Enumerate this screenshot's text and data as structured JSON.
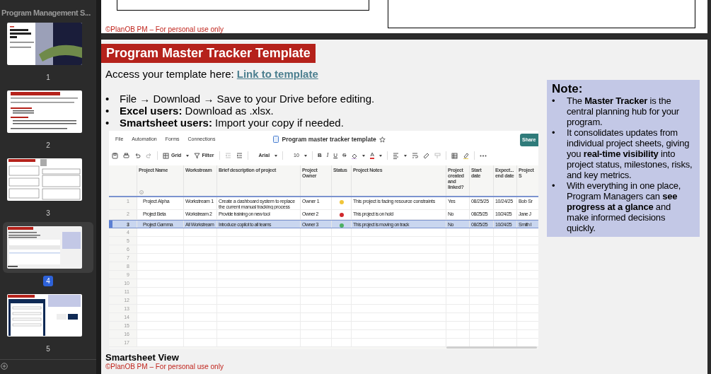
{
  "app": {
    "title": "Program Management S..."
  },
  "slides": [
    {
      "number": "1",
      "kind": "cover",
      "selected": false
    },
    {
      "number": "2",
      "kind": "text",
      "selected": false
    },
    {
      "number": "3",
      "kind": "form",
      "selected": false
    },
    {
      "number": "4",
      "kind": "tracker",
      "selected": true
    },
    {
      "number": "5",
      "kind": "intake",
      "selected": false
    }
  ],
  "previous_slide": {
    "footer": "©PlanOB PM – For personal use only"
  },
  "slide": {
    "title": "Program Master Tracker Template",
    "access_text": "Access your template here:",
    "link": "Link to template",
    "bullets": [
      {
        "marker": "•",
        "text": "File →  Download → Save to your Drive before editing."
      },
      {
        "marker": "•",
        "text": "**Excel users:** Download as .xlsx."
      },
      {
        "marker": "•",
        "text": "**Smartsheet users:** Import your copy if needed."
      }
    ],
    "sheet": {
      "menu": [
        "File",
        "Automation",
        "Forms",
        "Connections"
      ],
      "title": "Program master tracker template",
      "share": "Share",
      "toolbar": {
        "view": "Grid",
        "filter": "Filter",
        "font": "Arial",
        "size": "10",
        "format": [
          "B",
          "I",
          "U",
          "S"
        ],
        "text_color": "A"
      },
      "columns": [
        {
          "label": "Project Name",
          "kind": "text"
        },
        {
          "label": "Workstream",
          "kind": "text"
        },
        {
          "label": "Brief description of project",
          "kind": "text"
        },
        {
          "label": "Project Owner",
          "kind": "text"
        },
        {
          "label": "Status",
          "kind": "status"
        },
        {
          "label": "Project Notes",
          "kind": "text"
        },
        {
          "label": "Project created and linked?",
          "kind": "text"
        },
        {
          "label": "Start date",
          "kind": "text"
        },
        {
          "label": "Expect... end date",
          "kind": "text"
        },
        {
          "label": "Project S",
          "kind": "text"
        }
      ],
      "rows": [
        {
          "number": "1",
          "selected": false,
          "cells": [
            "Project Alpha",
            "Workstream 1",
            "Create a dashboard system to replace the current manual tracking process",
            "Owner 1",
            {
              "color": "#f0c53a"
            },
            "This project is facing resource constraints",
            "Yes",
            "08/25/25",
            "10/24/25",
            "Bob Sr"
          ]
        },
        {
          "number": "2",
          "selected": false,
          "cells": [
            "Project Beta",
            "Workstream 2",
            "Provide training on new tool",
            "Owner 2",
            {
              "color": "#d0282c"
            },
            "This project is on hold",
            "No",
            "08/25/25",
            "10/24/25",
            "Jane J"
          ]
        },
        {
          "number": "3",
          "selected": true,
          "cells": [
            "Project Gamma",
            "All Workstream",
            "Introduce copilot to all teams",
            "Owner 3",
            {
              "color": "#4caf63"
            },
            "This project is moving on track",
            "No",
            "08/25/25",
            "10/24/25",
            "Smith I"
          ]
        }
      ],
      "empty_rows": [
        "4",
        "5",
        "6",
        "7",
        "8",
        "9",
        "10",
        "11",
        "12",
        "13",
        "14",
        "15",
        "16",
        "17"
      ]
    },
    "caption": "Smartsheet View",
    "footer": "©PlanOB PM – For personal use only",
    "note": {
      "title": "Note:",
      "bullets": [
        {
          "marker": "•",
          "text": "The **Master Tracker** is the central planning hub for your program."
        },
        {
          "marker": "•",
          "text": "It consolidates updates from individual project sheets, giving you **real-time visibility** into project status, milestones, risks, and key metrics."
        },
        {
          "marker": "•",
          "text": "With everything in one place, Program Managers can **see progress at a glance** and make informed decisions quickly."
        }
      ]
    }
  }
}
